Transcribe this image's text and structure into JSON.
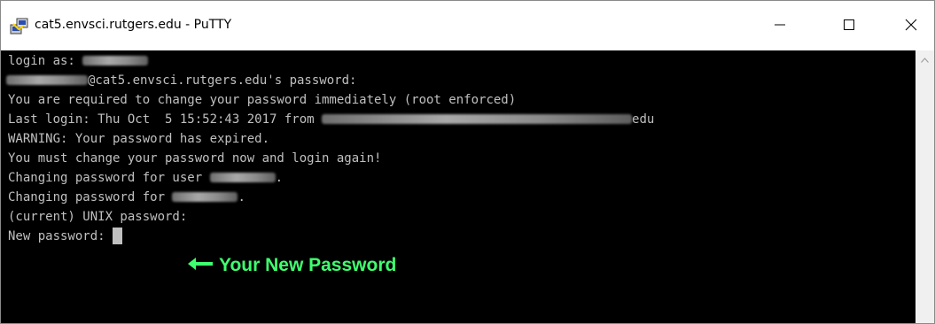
{
  "window": {
    "title": "cat5.envsci.rutgers.edu - PuTTY",
    "icon": "putty-icon",
    "controls": [
      "minimize-icon",
      "maximize-icon",
      "close-icon"
    ]
  },
  "terminal": {
    "lines": {
      "l1": "login as: ",
      "l2": "@cat5.envsci.rutgers.edu's password:",
      "l3": "You are required to change your password immediately (root enforced)",
      "l4_prefix": "Last login: Thu Oct  5 15:52:43 2017 from ",
      "l4_suffix": "edu",
      "l5": "WARNING: Your password has expired.",
      "l6": "You must change your password now and login again!",
      "l7_prefix": "Changing password for user ",
      "l7_suffix": ".",
      "l8_prefix": "Changing password for ",
      "l8_suffix": ".",
      "l9": "(current) UNIX password:",
      "l10": "New password: "
    },
    "colors": {
      "background": "#000000",
      "text": "#c0c0c0",
      "annotation": "#3fff6f"
    }
  },
  "annotation": {
    "text": "Your New Password",
    "arrow_icon": "left-arrow-icon"
  }
}
